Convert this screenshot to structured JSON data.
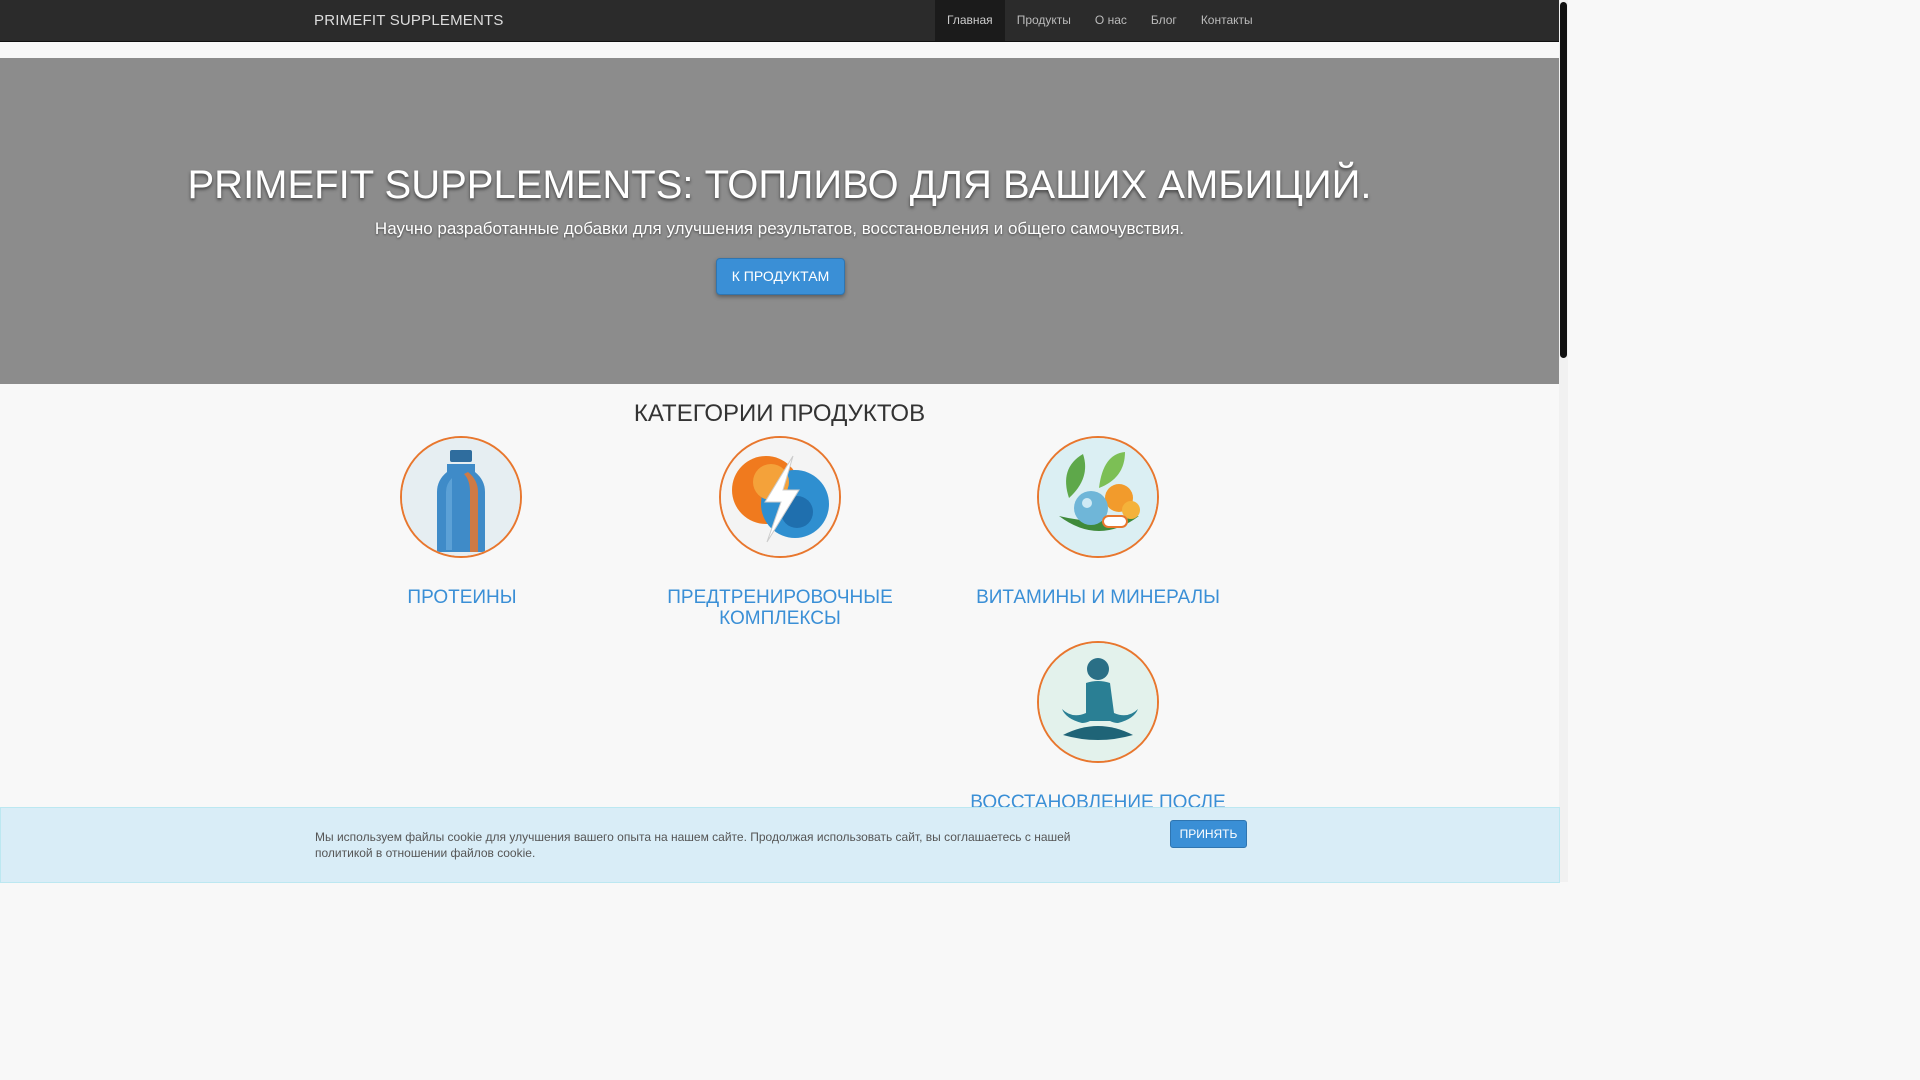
{
  "nav": {
    "brand": "PRIMEFIT SUPPLEMENTS",
    "items": [
      {
        "label": "Главная"
      },
      {
        "label": "Продукты"
      },
      {
        "label": "О нас"
      },
      {
        "label": "Блог"
      },
      {
        "label": "Контакты"
      }
    ],
    "active_index": 0
  },
  "hero": {
    "title": "PRIMEFIT SUPPLEMENTS: ТОПЛИВО ДЛЯ ВАШИХ АМБИЦИЙ.",
    "subtitle": "Научно разработанные добавки для улучшения результатов, восстановления и общего самочувствия.",
    "button_label": "К ПРОДУКТАМ"
  },
  "categories": {
    "title": "КАТЕГОРИИ ПРОДУКТОВ",
    "items": [
      {
        "label": "ПРОТЕИНЫ",
        "icon": "protein-bottle-icon"
      },
      {
        "label": "ПРЕДТРЕНИРОВОЧНЫЕ КОМПЛЕКСЫ",
        "icon": "energy-bolt-icon"
      },
      {
        "label": "ВИТАМИНЫ И МИНЕРАЛЫ",
        "icon": "vitamins-leaves-icon"
      },
      {
        "label": "ВОССТАНОВЛЕНИЕ ПОСЛЕ",
        "icon": "meditation-figure-icon"
      }
    ]
  },
  "cookie": {
    "text": "Мы используем файлы cookie для улучшения вашего опыта на нашем сайте. Продолжая использовать сайт, вы соглашаетесь с нашей политикой в отношении файлов cookie.",
    "button_label": "ПРИНЯТЬ"
  },
  "colors": {
    "accent": "#3a8fd6",
    "icon_ring": "#e8772e",
    "navbar": "#2b2b2b",
    "hero_bg": "#8c8c8c"
  }
}
